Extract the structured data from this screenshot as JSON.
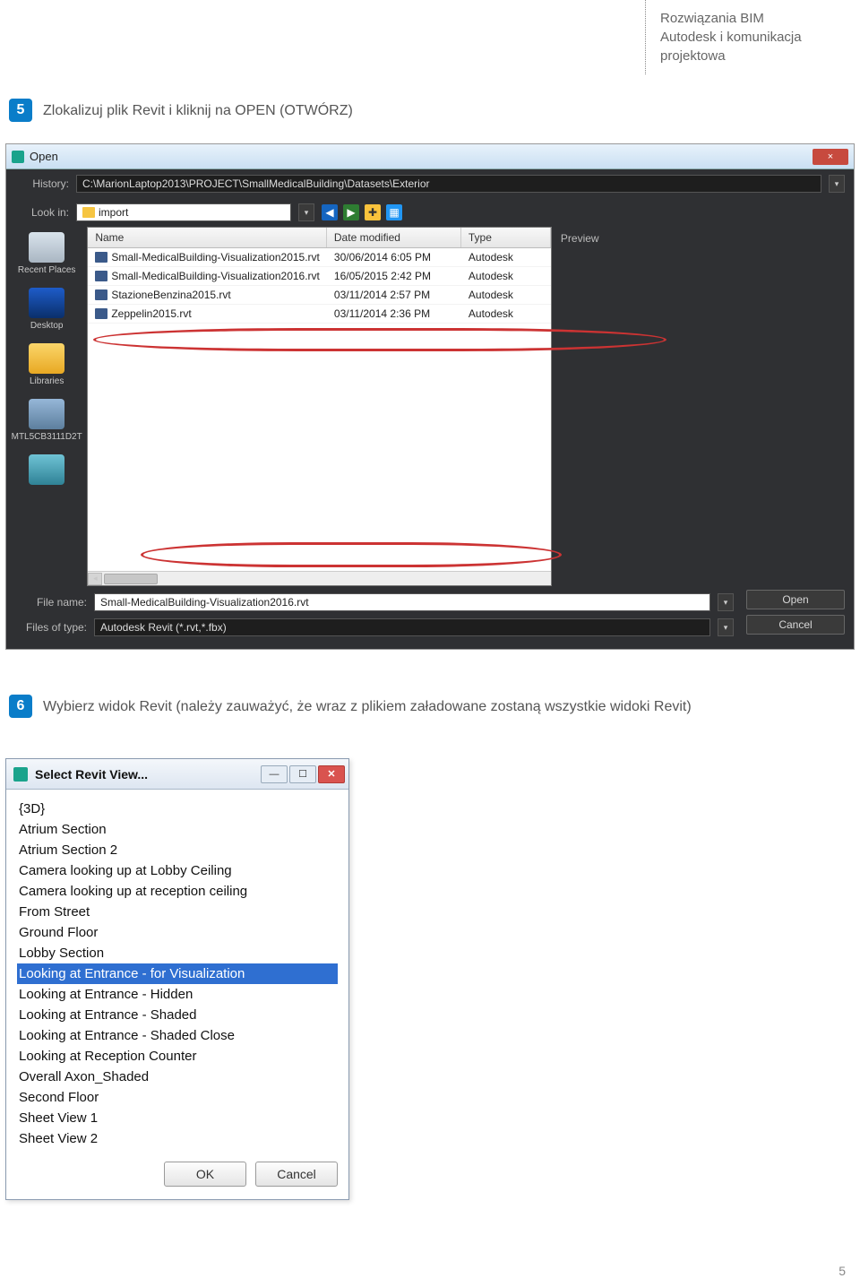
{
  "header": {
    "line1": "Rozwiązania BIM",
    "line2": "Autodesk i komunikacja",
    "line3": "projektowa"
  },
  "step5": {
    "num": "5",
    "text": "Zlokalizuj plik Revit i kliknij na OPEN (OTWÓRZ)"
  },
  "step6": {
    "num": "6",
    "text": "Wybierz widok Revit (należy zauważyć, że wraz z plikiem załadowane zostaną wszystkie widoki Revit)"
  },
  "open_dialog": {
    "title": "Open",
    "close_glyph": "×",
    "history_label": "History:",
    "history_value": "C:\\MarionLaptop2013\\PROJECT\\SmallMedicalBuilding\\Datasets\\Exterior",
    "lookin_label": "Look in:",
    "lookin_value": "import",
    "columns": {
      "name": "Name",
      "date": "Date modified",
      "type": "Type"
    },
    "files": [
      {
        "name": "Small-MedicalBuilding-Visualization2015.rvt",
        "date": "30/06/2014 6:05 PM",
        "type": "Autodesk"
      },
      {
        "name": "Small-MedicalBuilding-Visualization2016.rvt",
        "date": "16/05/2015 2:42 PM",
        "type": "Autodesk"
      },
      {
        "name": "StazioneBenzina2015.rvt",
        "date": "03/11/2014 2:57 PM",
        "type": "Autodesk"
      },
      {
        "name": "Zeppelin2015.rvt",
        "date": "03/11/2014 2:36 PM",
        "type": "Autodesk"
      }
    ],
    "preview_label": "Preview",
    "places": {
      "recent": "Recent Places",
      "desktop": "Desktop",
      "libraries": "Libraries",
      "computer": "MTL5CB3111D2T",
      "ftp": ""
    },
    "filename_label": "File name:",
    "filename_value": "Small-MedicalBuilding-Visualization2016.rvt",
    "filetype_label": "Files of type:",
    "filetype_value": "Autodesk Revit (*.rvt,*.fbx)",
    "open_btn": "Open",
    "cancel_btn": "Cancel"
  },
  "select_view": {
    "title": "Select Revit View...",
    "items": [
      "{3D}",
      "Atrium Section",
      "Atrium Section 2",
      "Camera looking up at Lobby Ceiling",
      "Camera looking up at reception ceiling",
      "From Street",
      "Ground Floor",
      "Lobby Section",
      "Looking at Entrance - for Visualization",
      "Looking at Entrance - Hidden",
      "Looking at Entrance - Shaded",
      "Looking at Entrance - Shaded Close",
      "Looking at Reception Counter",
      "Overall Axon_Shaded",
      "Second Floor",
      "Sheet View 1",
      "Sheet View 2"
    ],
    "selected_index": 8,
    "ok": "OK",
    "cancel": "Cancel"
  },
  "page_number": "5"
}
